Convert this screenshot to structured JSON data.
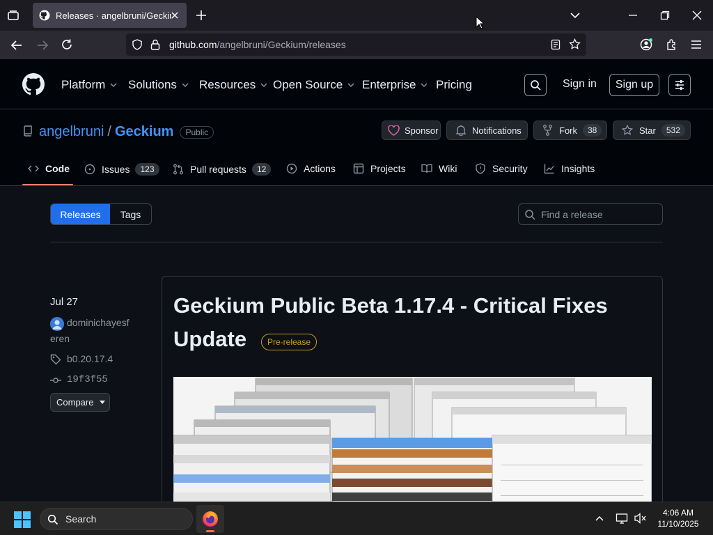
{
  "browser": {
    "tab_title": "Releases · angelbruni/Geckium",
    "url_domain": "github.com",
    "url_path": "/angelbruni/Geckium/releases"
  },
  "github_nav": {
    "items": [
      "Platform",
      "Solutions",
      "Resources",
      "Open Source",
      "Enterprise",
      "Pricing"
    ],
    "sign_in": "Sign in",
    "sign_up": "Sign up"
  },
  "repo": {
    "owner": "angelbruni",
    "separator": "/",
    "name": "Geckium",
    "visibility": "Public",
    "sponsor_label": "Sponsor",
    "notifications_label": "Notifications",
    "fork_label": "Fork",
    "fork_count": "38",
    "star_label": "Star",
    "star_count": "532"
  },
  "repo_tabs": [
    {
      "label": "Code",
      "active": true
    },
    {
      "label": "Issues",
      "count": "123"
    },
    {
      "label": "Pull requests",
      "count": "12"
    },
    {
      "label": "Actions"
    },
    {
      "label": "Projects"
    },
    {
      "label": "Wiki"
    },
    {
      "label": "Security"
    },
    {
      "label": "Insights"
    }
  ],
  "releases_page": {
    "toggle_releases": "Releases",
    "toggle_tags": "Tags",
    "search_placeholder": "Find a release"
  },
  "release": {
    "date": "Jul 27",
    "author_line1": "dominichayesf",
    "author_line2": "eren",
    "tag": "b0.20.17.4",
    "commit": "19f3f55",
    "compare_label": "Compare",
    "title_line1": "Geckium Public Beta 1.17.4 - Critical Fixes",
    "title_line2": "Update",
    "badge": "Pre-release"
  },
  "taskbar": {
    "search_label": "Search",
    "time": "4:06 AM",
    "date": "11/10/2025"
  },
  "colors": {
    "accent_blue": "#1f6feb",
    "link_blue": "#4493f8",
    "prerelease": "#d29922",
    "sponsor_pink": "#db61a2",
    "tab_underline": "#f78166"
  }
}
